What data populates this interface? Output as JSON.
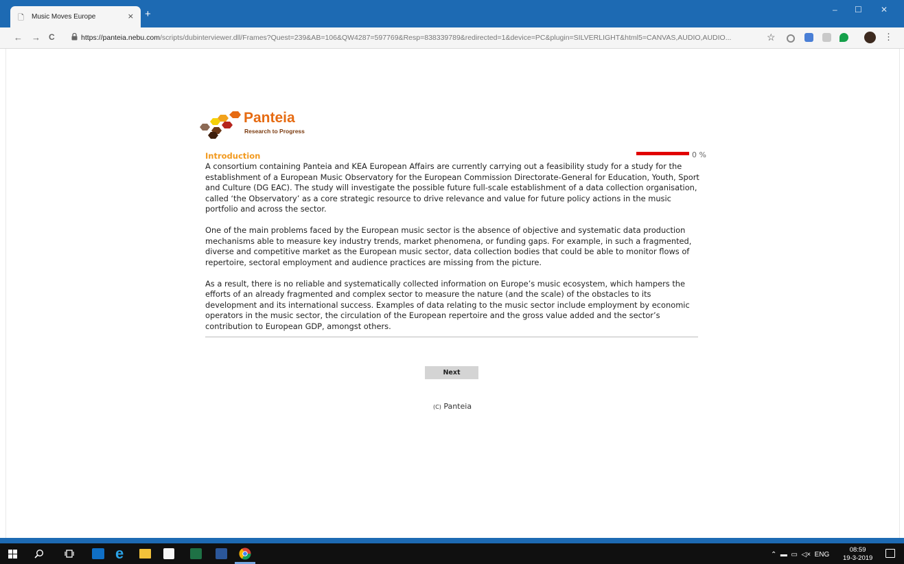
{
  "browser": {
    "tab_title": "Music Moves Europe",
    "tab_close": "×",
    "new_tab": "+",
    "window_controls": {
      "minimize": "–",
      "maximize": "☐",
      "close": "✕"
    },
    "nav": {
      "back": "←",
      "forward": "→",
      "reload": "C"
    },
    "url_host": "https://panteia.nebu.com",
    "url_rest": "/scripts/dubinterviewer.dll/Frames?Quest=239&AB=106&QW4287=597769&Resp=838339789&redirected=1&device=PC&plugin=SILVERLIGHT&html5=CANVAS,AUDIO,AUDIO...",
    "bookmark_icon": "☆",
    "menu_icon": "⋮"
  },
  "page": {
    "logo_name": "Panteia",
    "logo_tagline": "Research to Progress",
    "section_title": "Introduction",
    "progress_percent": 0,
    "progress_label": "0 %",
    "paragraphs": [
      "A consortium containing Panteia and KEA European Affairs are currently carrying out a feasibility study for a study for the establishment of a European Music Observatory for the European Commission Directorate-General for Education, Youth, Sport and Culture (DG EAC). The study will investigate the possible future full-scale establishment of a data collection organisation, called ‘the Observatory’ as a core strategic resource to drive relevance and value for future policy actions in the music portfolio and across the sector.",
      "One of the main problems faced by the European music sector is the absence of objective and systematic data production mechanisms able to measure key industry trends, market phenomena, or funding gaps. For example, in such a fragmented, diverse and competitive market as the European music sector, data collection bodies that could be able to monitor flows of repertoire, sectoral employment and audience practices are missing from the picture.",
      "As a result, there is no reliable and systematically collected information on Europe’s music ecosystem, which hampers the efforts of an already fragmented and complex sector to measure the nature (and the scale) of the obstacles to its development and its international success. Examples of data relating to the music sector include employment by economic operators in the music sector, the circulation of the European repertoire and the gross value added and the sector’s contribution to European GDP, amongst others."
    ],
    "next_label": "Next",
    "copyright_symbol": "(C)",
    "copyright_name": "Panteia"
  },
  "taskbar": {
    "tray_text": "ENG",
    "time": "08:59",
    "date": "19-3-2019"
  },
  "colors": {
    "chrome_blue": "#1d6ab3",
    "logo_orange": "#e66b12",
    "section_orange": "#f29a1f",
    "progress_red": "#e10000"
  }
}
